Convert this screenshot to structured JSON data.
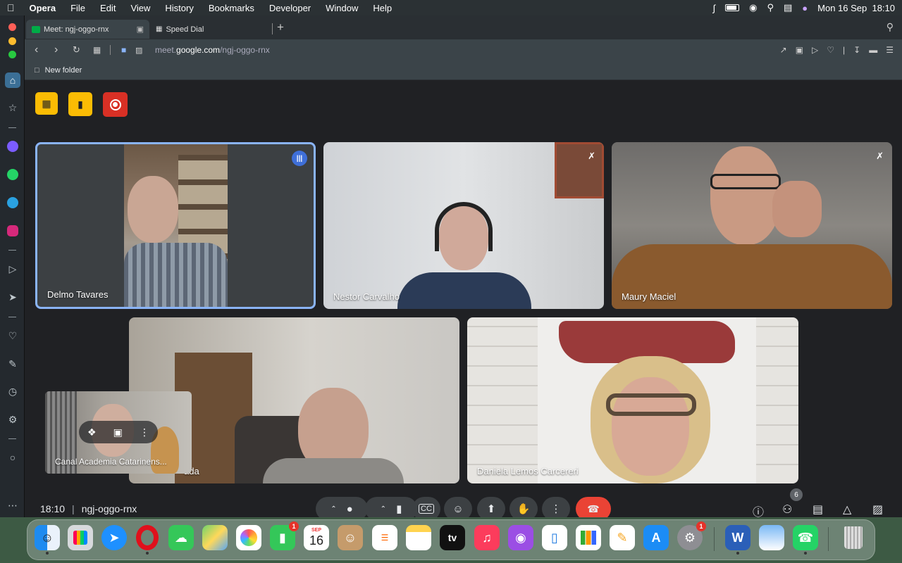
{
  "menubar": {
    "app_name": "Opera",
    "items": [
      "File",
      "Edit",
      "View",
      "History",
      "Bookmarks",
      "Developer",
      "Window",
      "Help"
    ],
    "clock": "Mon 16 Sep  18:10"
  },
  "tabs": [
    {
      "label": "Meet: ngj-oggo-rnx"
    },
    {
      "label": "Speed Dial"
    }
  ],
  "address": {
    "prefix": "meet.",
    "domain": "google.com",
    "path": "/ngj-oggo-rnx"
  },
  "bookmarks": {
    "folder": "New folder"
  },
  "participants": [
    {
      "name": "Delmo Tavares",
      "speaking": true
    },
    {
      "name": "Nestor Carvalho",
      "muted": true
    },
    {
      "name": "Maury Maciel",
      "muted": true
    },
    {
      "name": "ada"
    },
    {
      "name": "Daniela Lemos Carcereri"
    }
  ],
  "self_view": {
    "name": "Canal Academia Catarinens..."
  },
  "bottom": {
    "time": "18:10",
    "separator": "|",
    "meeting_code": "ngj-oggo-rnx",
    "people_count": "6"
  },
  "dock": {
    "calendar_month": "SEP",
    "calendar_day": "16",
    "facetime_badge": "1",
    "settings_badge": "1",
    "tv_label": "tv",
    "word_label": "W"
  },
  "colors": {
    "accent_blue": "#8ab4f8",
    "end_call": "#ea4335",
    "host_yellow": "#fbbc04",
    "record": "#d93025"
  }
}
